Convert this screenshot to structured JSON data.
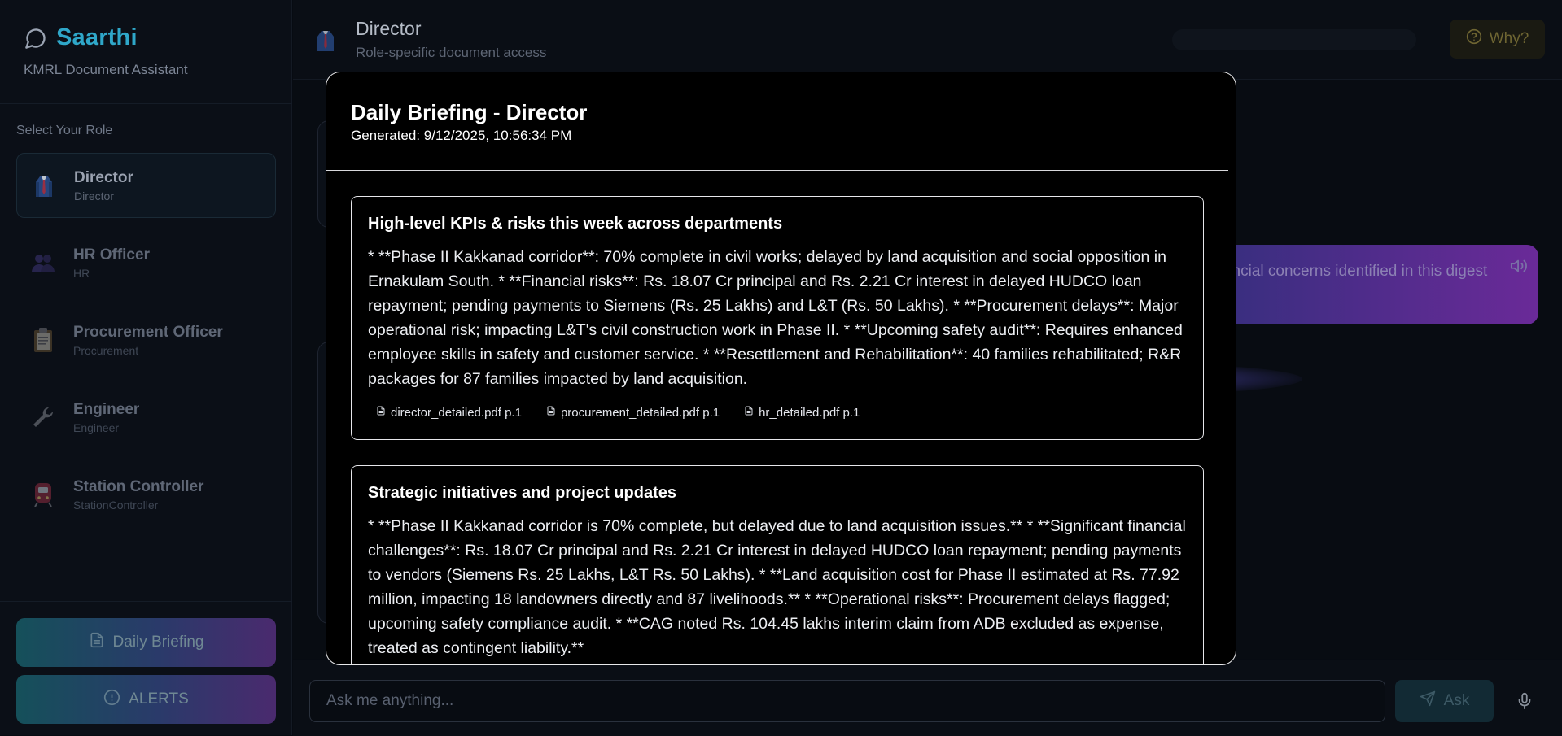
{
  "app": {
    "name": "Saarthi",
    "subtitle": "KMRL Document Assistant"
  },
  "sidebar": {
    "role_heading": "Select Your Role",
    "roles": [
      {
        "name": "Director",
        "sub": "Director",
        "icon": "director-icon",
        "active": true
      },
      {
        "name": "HR Officer",
        "sub": "HR",
        "icon": "people-icon",
        "active": false
      },
      {
        "name": "Procurement Officer",
        "sub": "Procurement",
        "icon": "clipboard-icon",
        "active": false
      },
      {
        "name": "Engineer",
        "sub": "Engineer",
        "icon": "wrench-icon",
        "active": false
      },
      {
        "name": "Station Controller",
        "sub": "StationController",
        "icon": "train-icon",
        "active": false
      }
    ],
    "daily_briefing_label": "Daily Briefing",
    "alerts_label": "ALERTS"
  },
  "header": {
    "title": "Director",
    "subtitle": "Role-specific document access",
    "why_label": "Why?"
  },
  "chat": {
    "user_message_visible": "r risks and financial concerns identified in this digest"
  },
  "input": {
    "placeholder": "Ask me anything...",
    "value": "",
    "ask_label": "Ask"
  },
  "modal": {
    "title": "Daily Briefing - Director",
    "generated": "Generated: 9/12/2025, 10:56:34 PM",
    "sections": [
      {
        "heading": "High-level KPIs & risks this week across departments",
        "text": "* **Phase II Kakkanad corridor**: 70% complete in civil works; delayed by land acquisition and social opposition in Ernakulam South. * **Financial risks**: Rs. 18.07 Cr principal and Rs. 2.21 Cr interest in delayed HUDCO loan repayment; pending payments to Siemens (Rs. 25 Lakhs) and L&T (Rs. 50 Lakhs). * **Procurement delays**: Major operational risk; impacting L&T's civil construction work in Phase II. * **Upcoming safety audit**: Requires enhanced employee skills in safety and customer service. * **Resettlement and Rehabilitation**: 40 families rehabilitated; R&R packages for 87 families impacted by land acquisition.",
        "citations": [
          "director_detailed.pdf p.1",
          "procurement_detailed.pdf p.1",
          "hr_detailed.pdf p.1"
        ]
      },
      {
        "heading": "Strategic initiatives and project updates",
        "text": "* **Phase II Kakkanad corridor is 70% complete, but delayed due to land acquisition issues.** * **Significant financial challenges**: Rs. 18.07 Cr principal and Rs. 2.21 Cr interest in delayed HUDCO loan repayment; pending payments to vendors (Siemens Rs. 25 Lakhs, L&T Rs. 50 Lakhs). * **Land acquisition cost for Phase II estimated at Rs. 77.92 million, impacting 18 landowners directly and 87 livelihoods.** * **Operational risks**: Procurement delays flagged; upcoming safety compliance audit. * **CAG noted Rs. 104.45 lakhs interim claim from ADB excluded as expense, treated as contingent liability.**",
        "citations": []
      }
    ]
  },
  "colors": {
    "brand": "#2fa7c9",
    "gradient_start": "#15505a",
    "gradient_end": "#4a2a6e",
    "modal_bg": "#000000",
    "modal_border": "#e8e8ea"
  }
}
